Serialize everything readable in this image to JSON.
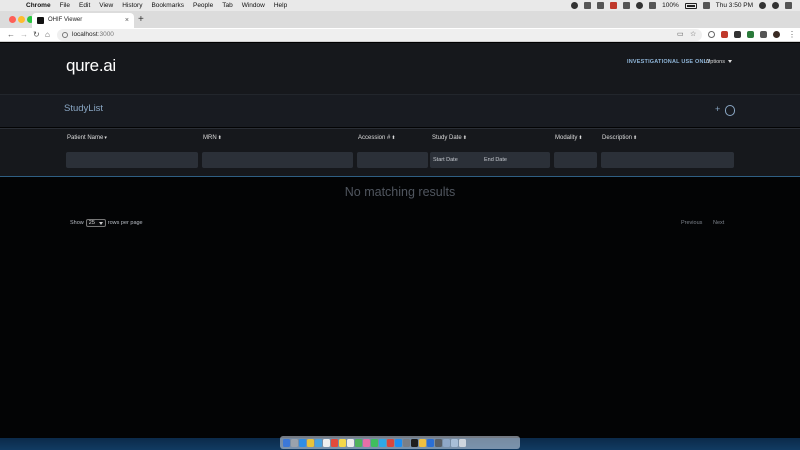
{
  "menubar": {
    "app_name": "Chrome",
    "items": [
      "File",
      "Edit",
      "View",
      "History",
      "Bookmarks",
      "People",
      "Tab",
      "Window",
      "Help"
    ],
    "battery": "100%",
    "clock": "Thu 3:50 PM"
  },
  "browser": {
    "tab_title": "OHIF Viewer",
    "tab_close": "×",
    "new_tab": "+",
    "url_host": "localhost",
    "url_port": ":3000"
  },
  "app": {
    "logo": "qure.ai",
    "investigational_label": "INVESTIGATIONAL USE ONLY",
    "options_label": "Options",
    "studylist_title": "StudyList",
    "add_label": "+",
    "columns": {
      "patient_name": "Patient Name",
      "mrn": "MRN",
      "accession": "Accession #",
      "study_date": "Study Date",
      "modality": "Modality",
      "description": "Description"
    },
    "sort_glyph_down": "▾",
    "sort_glyph_both": "⬍",
    "start_date_placeholder": "Start Date",
    "end_date_placeholder": "End Date",
    "no_results": "No matching results",
    "show_label": "Show",
    "rows_per_page_value": "25",
    "rows_per_page_label": "rows per page",
    "previous_label": "Previous",
    "next_label": "Next"
  },
  "colors": {
    "accent": "#8aa7c4",
    "investigational": "#8fb5d8",
    "header_bg": "#16181c",
    "body_bg": "#030405"
  }
}
